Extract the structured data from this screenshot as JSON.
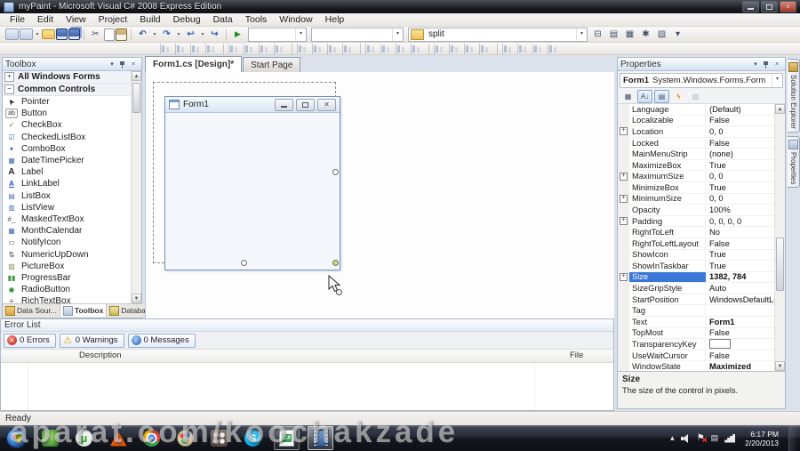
{
  "window": {
    "title": "myPaint - Microsoft Visual C# 2008 Express Edition"
  },
  "menu": {
    "items": [
      "File",
      "Edit",
      "View",
      "Project",
      "Build",
      "Debug",
      "Data",
      "Tools",
      "Window",
      "Help"
    ]
  },
  "toolbars": {
    "standard": [
      {
        "type": "icon",
        "name": "new-project-icon"
      },
      {
        "type": "icon",
        "name": "add-new-item-icon",
        "dd": true
      },
      {
        "type": "icon",
        "name": "open-file-icon"
      },
      {
        "type": "icon",
        "name": "save-icon"
      },
      {
        "type": "icon",
        "name": "save-all-icon"
      },
      {
        "type": "sep"
      },
      {
        "type": "icon",
        "name": "cut-icon",
        "glyph": "✂"
      },
      {
        "type": "icon",
        "name": "copy-icon"
      },
      {
        "type": "icon",
        "name": "paste-icon"
      },
      {
        "type": "sep"
      },
      {
        "type": "icon",
        "name": "undo-icon",
        "glyph": "↶",
        "dd": true
      },
      {
        "type": "icon",
        "name": "redo-icon",
        "glyph": "↷",
        "dd": true
      },
      {
        "type": "icon",
        "name": "navigate-backward-icon",
        "glyph": "↩",
        "dd": true
      },
      {
        "type": "icon",
        "name": "navigate-forward-icon",
        "glyph": "↪"
      },
      {
        "type": "sep"
      },
      {
        "type": "icon",
        "name": "start-debugging-icon",
        "glyph": "▶"
      },
      {
        "type": "combo",
        "name": "toolbar-combo-a",
        "value": ""
      },
      {
        "type": "combo",
        "name": "toolbar-combo-b",
        "value": ""
      },
      {
        "type": "combo",
        "name": "find-combo",
        "value": "split",
        "icon": true
      },
      {
        "type": "icon",
        "name": "solution-explorer-icon",
        "glyph": "⊟"
      },
      {
        "type": "icon",
        "name": "properties-window-icon",
        "glyph": "▤"
      },
      {
        "type": "icon",
        "name": "object-browser-icon",
        "glyph": "▦"
      },
      {
        "type": "icon",
        "name": "toolbox-window-icon",
        "glyph": "✱"
      },
      {
        "type": "icon",
        "name": "start-page-icon",
        "glyph": "▧"
      },
      {
        "type": "icon",
        "name": "toolbar-options-icon",
        "glyph": "▾"
      }
    ],
    "layout_icons": [
      "align-to-grid",
      "align-lefts",
      "align-centers",
      "align-rights",
      "align-tops",
      "align-middles",
      "align-bottoms",
      "make-same-width",
      "size-to-grid",
      "make-same-height",
      "make-same-size",
      "make-horizontal-spacing-equal",
      "increase-horizontal-spacing",
      "decrease-horizontal-spacing",
      "remove-horizontal-spacing",
      "make-vertical-spacing-equal",
      "increase-vertical-spacing",
      "decrease-vertical-spacing",
      "remove-vertical-spacing",
      "center-horizontally",
      "center-vertically",
      "bring-to-front",
      "send-to-back",
      "layout-toolbar-options"
    ]
  },
  "toolbox": {
    "title": "Toolbox",
    "sections": [
      {
        "label": "All Windows Forms",
        "state": "collapsed"
      },
      {
        "label": "Common Controls",
        "state": "expanded"
      }
    ],
    "items": [
      {
        "label": "Pointer",
        "icon": "pointer-icon",
        "glyph": "➤",
        "color": "#222222"
      },
      {
        "label": "Button",
        "icon": "button-icon",
        "glyph": "ab",
        "color": "#444444"
      },
      {
        "label": "CheckBox",
        "icon": "checkbox-icon",
        "glyph": "✓",
        "color": "#2c8a2c"
      },
      {
        "label": "CheckedListBox",
        "icon": "checkedlistbox-icon",
        "glyph": "☑",
        "color": "#4a6fae"
      },
      {
        "label": "ComboBox",
        "icon": "combobox-icon",
        "glyph": "▾",
        "color": "#4a6fae"
      },
      {
        "label": "DateTimePicker",
        "icon": "datetimepicker-icon",
        "glyph": "▦",
        "color": "#4a6fae"
      },
      {
        "label": "Label",
        "icon": "label-icon",
        "glyph": "A",
        "color": "#222222"
      },
      {
        "label": "LinkLabel",
        "icon": "linklabel-icon",
        "glyph": "A",
        "color": "#2a52c0"
      },
      {
        "label": "ListBox",
        "icon": "listbox-icon",
        "glyph": "▤",
        "color": "#4a6fae"
      },
      {
        "label": "ListView",
        "icon": "listview-icon",
        "glyph": "▥",
        "color": "#4a6fae"
      },
      {
        "label": "MaskedTextBox",
        "icon": "maskedtextbox-icon",
        "glyph": "#_",
        "color": "#555555"
      },
      {
        "label": "MonthCalendar",
        "icon": "monthcalendar-icon",
        "glyph": "▦",
        "color": "#3f6fb5"
      },
      {
        "label": "NotifyIcon",
        "icon": "notifyicon-icon",
        "glyph": "▭",
        "color": "#555555"
      },
      {
        "label": "NumericUpDown",
        "icon": "numericupdown-icon",
        "glyph": "⇅",
        "color": "#444444"
      },
      {
        "label": "PictureBox",
        "icon": "picturebox-icon",
        "glyph": "▨",
        "color": "#7a9a4f"
      },
      {
        "label": "ProgressBar",
        "icon": "progressbar-icon",
        "glyph": "▮▮",
        "color": "#3d9e3d"
      },
      {
        "label": "RadioButton",
        "icon": "radiobutton-icon",
        "glyph": "◉",
        "color": "#2c8a2c"
      },
      {
        "label": "RichTextBox",
        "icon": "richtextbox-icon",
        "glyph": "≡",
        "color": "#555555"
      }
    ],
    "bottom_tabs": [
      {
        "label": "Data Sour...",
        "name": "data-sources-tab",
        "active": false
      },
      {
        "label": "Toolbox",
        "name": "toolbox-tab",
        "active": true
      },
      {
        "label": "Database ...",
        "name": "database-explorer-tab",
        "active": false
      }
    ]
  },
  "document": {
    "tabs": [
      "Form1.cs [Design]*",
      "Start Page"
    ],
    "form": {
      "title": "Form1"
    }
  },
  "properties": {
    "title": "Properties",
    "object_name": "Form1",
    "object_type": "System.Windows.Forms.Form",
    "toolbar": [
      {
        "name": "categorized-icon",
        "glyph": "▦"
      },
      {
        "name": "alphabetical-icon",
        "glyph": "A↓",
        "pressed": true
      },
      {
        "name": "properties-icon",
        "glyph": "▤",
        "pressed": true
      },
      {
        "name": "events-icon",
        "glyph": "ϟ"
      },
      {
        "name": "property-pages-icon",
        "glyph": "▧",
        "disabled": true
      }
    ],
    "rows": [
      {
        "name": "Language",
        "value": "(Default)"
      },
      {
        "name": "Localizable",
        "value": "False"
      },
      {
        "name": "Location",
        "value": "0, 0",
        "expandable": true
      },
      {
        "name": "Locked",
        "value": "False"
      },
      {
        "name": "MainMenuStrip",
        "value": "(none)"
      },
      {
        "name": "MaximizeBox",
        "value": "True"
      },
      {
        "name": "MaximumSize",
        "value": "0, 0",
        "expandable": true
      },
      {
        "name": "MinimizeBox",
        "value": "True"
      },
      {
        "name": "MinimumSize",
        "value": "0, 0",
        "expandable": true
      },
      {
        "name": "Opacity",
        "value": "100%"
      },
      {
        "name": "Padding",
        "value": "0, 0, 0, 0",
        "expandable": true
      },
      {
        "name": "RightToLeft",
        "value": "No"
      },
      {
        "name": "RightToLeftLayout",
        "value": "False"
      },
      {
        "name": "ShowIcon",
        "value": "True"
      },
      {
        "name": "ShowInTaskbar",
        "value": "True"
      },
      {
        "name": "Size",
        "value": "1382, 784",
        "expandable": true,
        "selected": true
      },
      {
        "name": "SizeGripStyle",
        "value": "Auto"
      },
      {
        "name": "StartPosition",
        "value": "WindowsDefaultLocation"
      },
      {
        "name": "Tag",
        "value": ""
      },
      {
        "name": "Text",
        "value": "Form1",
        "bold": true
      },
      {
        "name": "TopMost",
        "value": "False"
      },
      {
        "name": "TransparencyKey",
        "value": "",
        "swatch": true
      },
      {
        "name": "UseWaitCursor",
        "value": "False"
      },
      {
        "name": "WindowState",
        "value": "Maximized",
        "bold": true
      }
    ],
    "description_title": "Size",
    "description_text": "The size of the control in pixels."
  },
  "right_tabs": [
    {
      "label": "Solution Explorer",
      "name": "autohide-tab-solution-explorer"
    },
    {
      "label": "Properties",
      "name": "autohide-tab-properties"
    }
  ],
  "error_list": {
    "title": "Error List",
    "buttons": [
      "0 Errors",
      "0 Warnings",
      "0 Messages"
    ],
    "columns": [
      "Description",
      "File"
    ]
  },
  "status_bar": {
    "text": "Ready"
  },
  "taskbar": {
    "icons": [
      {
        "name": "start",
        "label": "start-button"
      },
      {
        "name": "green-tool"
      },
      {
        "name": "utorrent",
        "glyph": "µ"
      },
      {
        "name": "matlab"
      },
      {
        "name": "chrome"
      },
      {
        "name": "paint"
      },
      {
        "name": "app-grid"
      },
      {
        "name": "skype",
        "glyph": "S"
      },
      {
        "name": "visual-csharp",
        "glyph": "C#",
        "active": true
      },
      {
        "name": "movie-maker",
        "current": true
      }
    ],
    "tray": [
      {
        "name": "show-hidden-icons-icon",
        "glyph": "▴"
      },
      {
        "name": "volume-icon"
      },
      {
        "name": "action-center-flag-icon"
      },
      {
        "name": "clipboard-icon",
        "glyph": "▤"
      },
      {
        "name": "network-icon"
      }
    ],
    "clock_time": "6:17 PM",
    "clock_date": "2/20/2013"
  },
  "watermark": "aparat.com/koochakzade"
}
